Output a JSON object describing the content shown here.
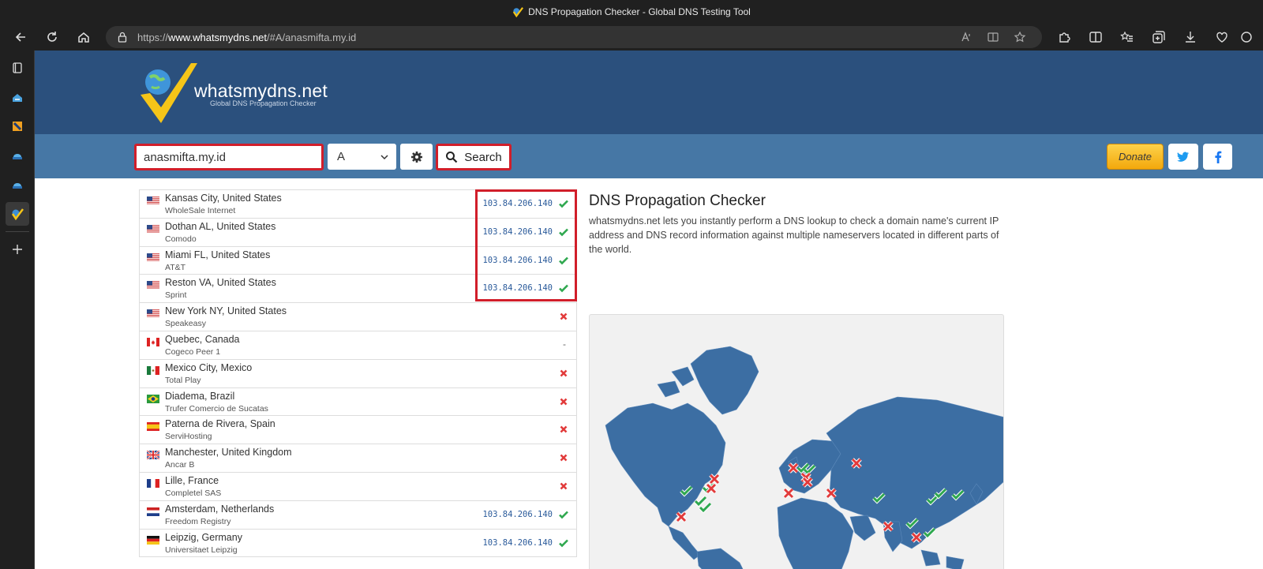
{
  "browser": {
    "window_title": "DNS Propagation Checker - Global DNS Testing Tool",
    "url_prefix": "https://",
    "url_host": "www.whatsmydns.net",
    "url_path": "/#A/anasmifta.my.id"
  },
  "site": {
    "logo_name": "whatsmydns.net",
    "logo_tagline": "Global DNS Propagation Checker"
  },
  "search": {
    "domain_value": "anasmifta.my.id",
    "record_type": "A",
    "search_label": "Search",
    "donate_label": "Donate"
  },
  "results": [
    {
      "location": "Kansas City, United States",
      "provider": "WholeSale Internet",
      "flag": "us",
      "ip": "103.84.206.140",
      "status": "ok"
    },
    {
      "location": "Dothan AL, United States",
      "provider": "Comodo",
      "flag": "us",
      "ip": "103.84.206.140",
      "status": "ok"
    },
    {
      "location": "Miami FL, United States",
      "provider": "AT&T",
      "flag": "us",
      "ip": "103.84.206.140",
      "status": "ok"
    },
    {
      "location": "Reston VA, United States",
      "provider": "Sprint",
      "flag": "us",
      "ip": "103.84.206.140",
      "status": "ok"
    },
    {
      "location": "New York NY, United States",
      "provider": "Speakeasy",
      "flag": "us",
      "ip": "",
      "status": "fail"
    },
    {
      "location": "Quebec, Canada",
      "provider": "Cogeco Peer 1",
      "flag": "ca",
      "ip": "",
      "status": "none"
    },
    {
      "location": "Mexico City, Mexico",
      "provider": "Total Play",
      "flag": "mx",
      "ip": "",
      "status": "fail"
    },
    {
      "location": "Diadema, Brazil",
      "provider": "Trufer Comercio de Sucatas",
      "flag": "br",
      "ip": "",
      "status": "fail"
    },
    {
      "location": "Paterna de Rivera, Spain",
      "provider": "ServiHosting",
      "flag": "es",
      "ip": "",
      "status": "fail"
    },
    {
      "location": "Manchester, United Kingdom",
      "provider": "Ancar B",
      "flag": "gb",
      "ip": "",
      "status": "fail"
    },
    {
      "location": "Lille, France",
      "provider": "Completel SAS",
      "flag": "fr",
      "ip": "",
      "status": "fail"
    },
    {
      "location": "Amsterdam, Netherlands",
      "provider": "Freedom Registry",
      "flag": "nl",
      "ip": "103.84.206.140",
      "status": "ok"
    },
    {
      "location": "Leipzig, Germany",
      "provider": "Universitaet Leipzig",
      "flag": "de",
      "ip": "103.84.206.140",
      "status": "ok"
    }
  ],
  "info": {
    "title": "DNS Propagation Checker",
    "text": "whatsmydns.net lets you instantly perform a DNS lookup to check a domain name's current IP address and DNS record information against multiple nameservers located in different parts of the world."
  },
  "colors": {
    "hero": "#2b507d",
    "search_bar": "#4677a5",
    "highlight": "#d11e2a",
    "ok": "#2fa84f",
    "fail": "#e23b3b"
  }
}
